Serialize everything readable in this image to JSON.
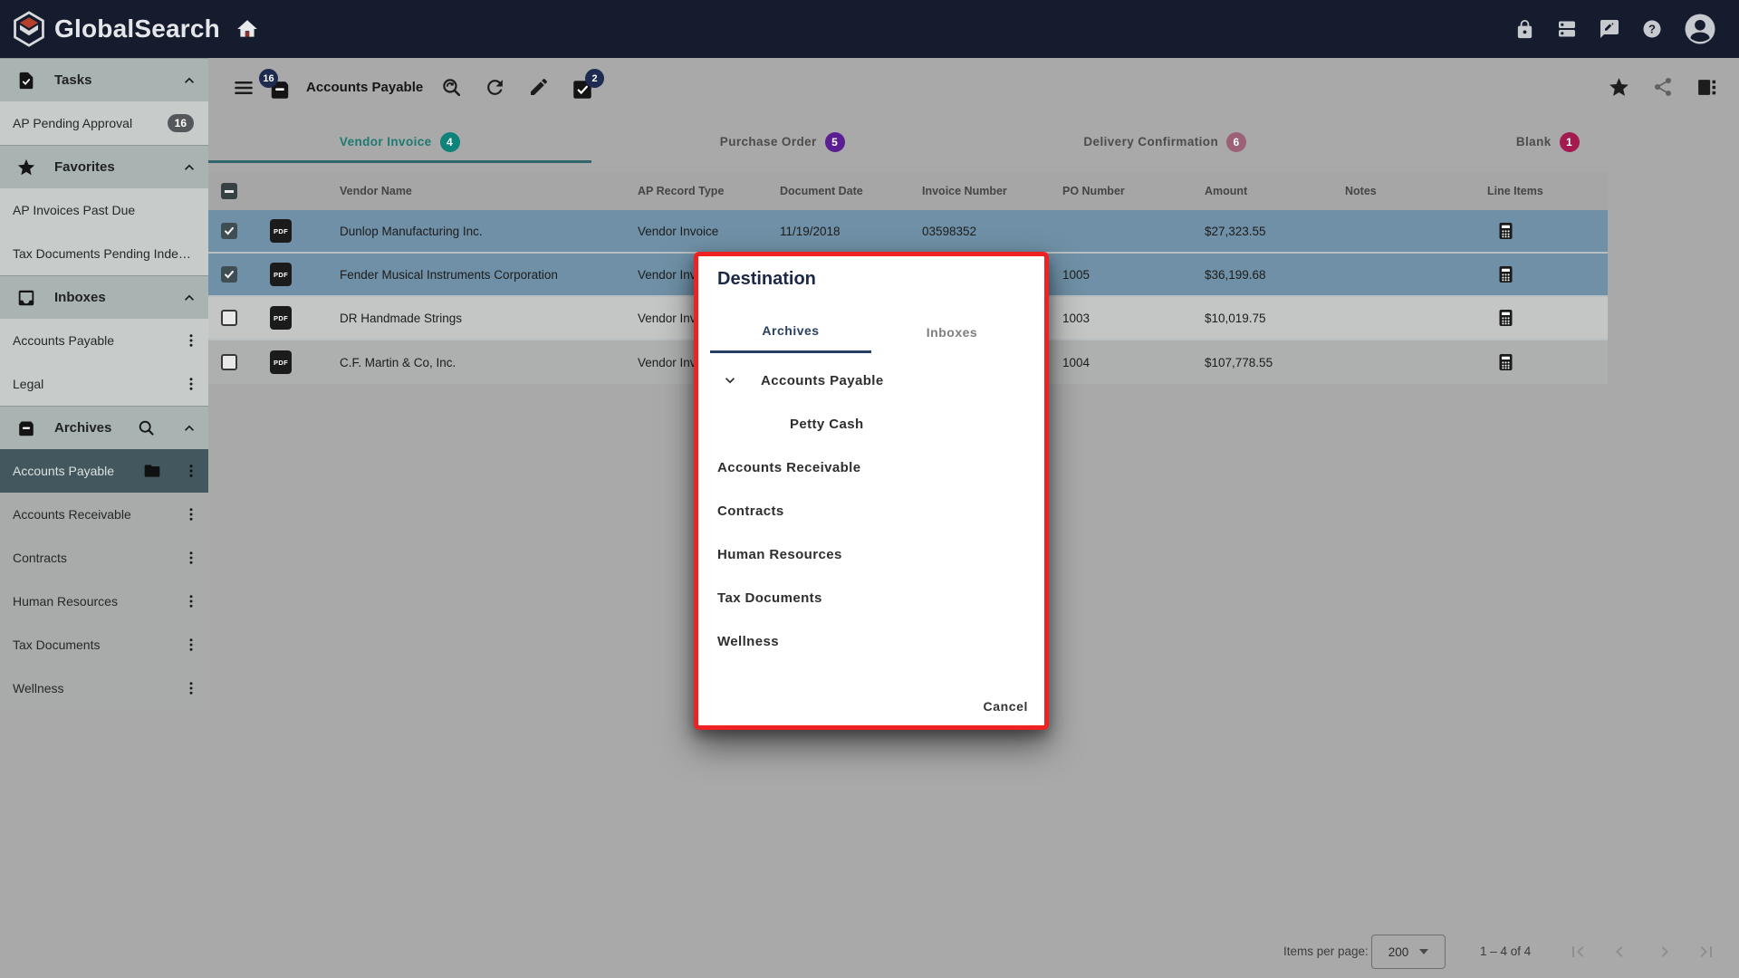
{
  "colors": {
    "navbar_bg": "#141c2e",
    "badge_navy": "#1e2b50",
    "tab_active_teal": "#1d7a72",
    "badge_teal": "#0e837a",
    "badge_purple": "#5a1d92",
    "badge_rose": "#9a6177",
    "badge_crimson": "#a31a50",
    "selected_row_blue": "#6f90a6",
    "selected_archive_bg": "#42585e",
    "modal_border_red": "#ee2222",
    "modal_navy": "#263e66"
  },
  "navbar": {
    "brand": "GlobalSearch"
  },
  "sidebar": {
    "sections": [
      {
        "label": "Tasks",
        "items": [
          {
            "label": "AP Pending Approval",
            "badge": "16"
          }
        ]
      },
      {
        "label": "Favorites",
        "items": [
          {
            "label": "AP Invoices Past Due"
          },
          {
            "label": "Tax Documents Pending Inde…"
          }
        ]
      },
      {
        "label": "Inboxes",
        "items": [
          {
            "label": "Accounts Payable"
          },
          {
            "label": "Legal"
          }
        ]
      },
      {
        "label": "Archives",
        "items": [
          {
            "label": "Accounts Payable",
            "selected": true
          },
          {
            "label": "Accounts Receivable"
          },
          {
            "label": "Contracts"
          },
          {
            "label": "Human Resources"
          },
          {
            "label": "Tax Documents"
          },
          {
            "label": "Wellness"
          }
        ]
      }
    ]
  },
  "toolbar": {
    "inbox_badge": "16",
    "title": "Accounts Payable",
    "tasks_badge": "2"
  },
  "view_tabs": [
    {
      "label": "Vendor Invoice",
      "count": "4",
      "active": true
    },
    {
      "label": "Purchase Order",
      "count": "5",
      "active": false
    },
    {
      "label": "Delivery Confirmation",
      "count": "6",
      "active": false
    },
    {
      "label": "Blank",
      "count": "1",
      "active": false
    }
  ],
  "table": {
    "columns": [
      "Vendor Name",
      "AP Record Type",
      "Document Date",
      "Invoice Number",
      "PO Number",
      "Amount",
      "Notes",
      "Line Items"
    ],
    "rows": [
      {
        "vendor": "Dunlop Manufacturing Inc.",
        "type": "Vendor Invoice",
        "date": "11/19/2018",
        "invoice": "03598352",
        "po": "",
        "amount": "$27,323.55",
        "notes": "",
        "selected": true
      },
      {
        "vendor": "Fender Musical Instruments Corporation",
        "type": "Vendor Invoice",
        "date": "",
        "invoice": "",
        "po": "1005",
        "amount": "$36,199.68",
        "notes": "",
        "selected": true
      },
      {
        "vendor": "DR Handmade Strings",
        "type": "Vendor Invoice",
        "date": "",
        "invoice": "",
        "po": "1003",
        "amount": "$10,019.75",
        "notes": "",
        "selected": false
      },
      {
        "vendor": "C.F. Martin & Co, Inc.",
        "type": "Vendor Invoice",
        "date": "",
        "invoice": "",
        "po": "1004",
        "amount": "$107,778.55",
        "notes": "",
        "selected": false
      }
    ],
    "pdf_label": "PDF"
  },
  "modal": {
    "title": "Destination",
    "tabs": [
      {
        "label": "Archives",
        "active": true
      },
      {
        "label": "Inboxes",
        "active": false
      }
    ],
    "tree": [
      {
        "label": "Accounts Payable",
        "level": 1,
        "expanded": true
      },
      {
        "label": "Petty Cash",
        "level": 2
      },
      {
        "label": "Accounts Receivable",
        "level": 0
      },
      {
        "label": "Contracts",
        "level": 0
      },
      {
        "label": "Human Resources",
        "level": 0
      },
      {
        "label": "Tax Documents",
        "level": 0
      },
      {
        "label": "Wellness",
        "level": 0
      }
    ],
    "cancel_label": "Cancel"
  },
  "pagination": {
    "items_per_page_label": "Items per page:",
    "page_size": "200",
    "range_label": "1 – 4 of 4"
  }
}
